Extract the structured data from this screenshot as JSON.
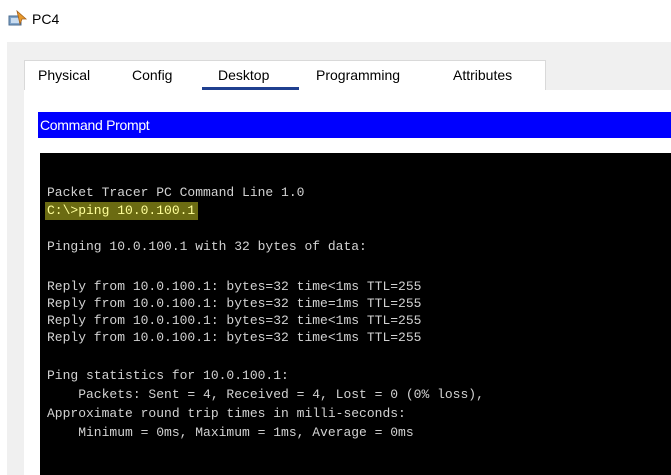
{
  "window": {
    "title": "PC4",
    "icon": "pc-device-icon"
  },
  "tabs": [
    {
      "label": "Physical",
      "active": false
    },
    {
      "label": "Config",
      "active": false
    },
    {
      "label": "Desktop",
      "active": true
    },
    {
      "label": "Programming",
      "active": false
    },
    {
      "label": "Attributes",
      "active": false
    }
  ],
  "command_prompt": {
    "header": "Command Prompt",
    "highlight_color": "#6b6b12",
    "header_color": "#0000ff",
    "lines": [
      "Packet Tracer PC Command Line 1.0",
      "C:\\>ping 10.0.100.1",
      "",
      "Pinging 10.0.100.1 with 32 bytes of data:",
      "",
      "Reply from 10.0.100.1: bytes=32 time<1ms TTL=255",
      "Reply from 10.0.100.1: bytes=32 time=1ms TTL=255",
      "Reply from 10.0.100.1: bytes=32 time<1ms TTL=255",
      "Reply from 10.0.100.1: bytes=32 time<1ms TTL=255",
      "",
      "Ping statistics for 10.0.100.1:",
      "    Packets: Sent = 4, Received = 4, Lost = 0 (0% loss),",
      "Approximate round trip times in milli-seconds:",
      "    Minimum = 0ms, Maximum = 1ms, Average = 0ms"
    ]
  }
}
